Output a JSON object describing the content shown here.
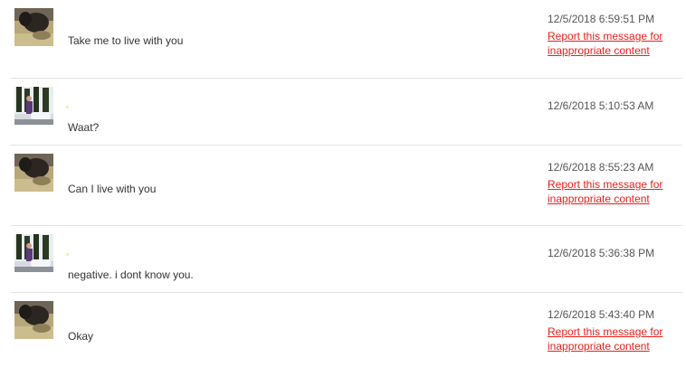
{
  "messages": [
    {
      "sender": "other",
      "avatar_icon": "user-photo-dark-icon",
      "text": "Take me to live with you",
      "timestamp": "12/5/2018 6:59:51 PM",
      "report_label": "Report this message for inappropriate content"
    },
    {
      "sender": "self",
      "avatar_icon": "user-photo-trees-icon",
      "text": "Waat?",
      "timestamp": "12/6/2018 5:10:53 AM",
      "report_label": ""
    },
    {
      "sender": "other",
      "avatar_icon": "user-photo-dark-icon",
      "text": "Can I live with you",
      "timestamp": "12/6/2018 8:55:23 AM",
      "report_label": "Report this message for inappropriate content"
    },
    {
      "sender": "self",
      "avatar_icon": "user-photo-trees-icon",
      "text": "negative. i dont know you.",
      "timestamp": "12/6/2018 5:36:38 PM",
      "report_label": ""
    },
    {
      "sender": "other",
      "avatar_icon": "user-photo-dark-icon",
      "text": "Okay",
      "timestamp": "12/6/2018 5:43:40 PM",
      "report_label": "Report this message for inappropriate content"
    }
  ],
  "colors": {
    "report_link": "#e8201a",
    "timestamp": "#555555",
    "message_text": "#333333",
    "divider": "#e3e3e3"
  }
}
